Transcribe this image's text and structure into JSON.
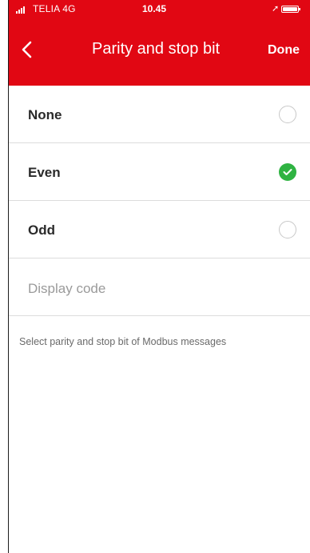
{
  "status_bar": {
    "carrier": "TELIA  4G",
    "time": "10.45",
    "location_glyph": "➚"
  },
  "nav": {
    "title": "Parity and stop bit",
    "done_label": "Done"
  },
  "options": [
    {
      "label": "None",
      "selected": false
    },
    {
      "label": "Even",
      "selected": true
    },
    {
      "label": "Odd",
      "selected": false
    }
  ],
  "display_code": {
    "label": "Display code"
  },
  "hint": "Select parity and stop bit of Modbus messages",
  "colors": {
    "accent": "#e10713",
    "selected": "#2fb342",
    "divider": "#dcdcdc"
  }
}
